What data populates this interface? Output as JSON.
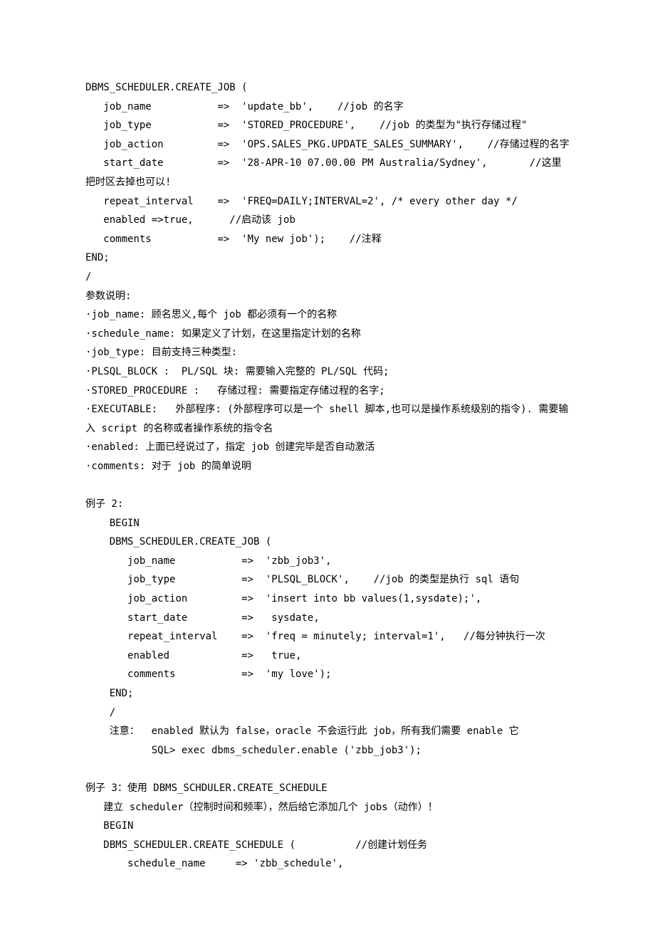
{
  "lines": [
    "DBMS_SCHEDULER.CREATE_JOB (",
    "   job_name           =>  'update_bb',    //job 的名字",
    "   job_type           =>  'STORED_PROCEDURE',    //job 的类型为\"执行存储过程\"",
    "   job_action         =>  'OPS.SALES_PKG.UPDATE_SALES_SUMMARY',    //存储过程的名字",
    "   start_date         =>  '28-APR-10 07.00.00 PM Australia/Sydney',       //这里把时区去掉也可以!",
    "   repeat_interval    =>  'FREQ=DAILY;INTERVAL=2', /* every other day */",
    "   enabled =>true,      //启动该 job",
    "   comments           =>  'My new job');    //注释",
    "END;",
    "/",
    "参数说明:",
    "·job_name: 顾名思义,每个 job 都必须有一个的名称",
    "·schedule_name: 如果定义了计划，在这里指定计划的名称",
    "·job_type: 目前支持三种类型:",
    "·PLSQL_BLOCK :  PL/SQL 块: 需要输入完整的 PL/SQL 代码;",
    "·STORED_PROCEDURE :   存储过程: 需要指定存储过程的名字;",
    "·EXECUTABLE:   外部程序: (外部程序可以是一个 shell 脚本,也可以是操作系统级别的指令). 需要输入 script 的名称或者操作系统的指令名",
    "·enabled: 上面已经说过了，指定 job 创建完毕是否自动激活",
    "·comments: 对于 job 的简单说明",
    "",
    "例子 2:",
    "    BEGIN",
    "    DBMS_SCHEDULER.CREATE_JOB (",
    "       job_name           =>  'zbb_job3',",
    "       job_type           =>  'PLSQL_BLOCK',    //job 的类型是执行 sql 语句",
    "       job_action         =>  'insert into bb values(1,sysdate);',",
    "       start_date         =>   sysdate,",
    "       repeat_interval    =>  'freq = minutely; interval=1',   //每分钟执行一次",
    "       enabled            =>   true,",
    "       comments           =>  'my love');",
    "    END;",
    "    /",
    "    注意：  enabled 默认为 false，oracle 不会运行此 job，所有我们需要 enable 它",
    "           SQL> exec dbms_scheduler.enable ('zbb_job3');",
    "",
    "例子 3：使用 DBMS_SCHDULER.CREATE_SCHEDULE",
    "   建立 scheduler（控制时间和频率），然后给它添加几个 jobs（动作）！",
    "   BEGIN",
    "   DBMS_SCHEDULER.CREATE_SCHEDULE (          //创建计划任务",
    "       schedule_name     => 'zbb_schedule',"
  ]
}
